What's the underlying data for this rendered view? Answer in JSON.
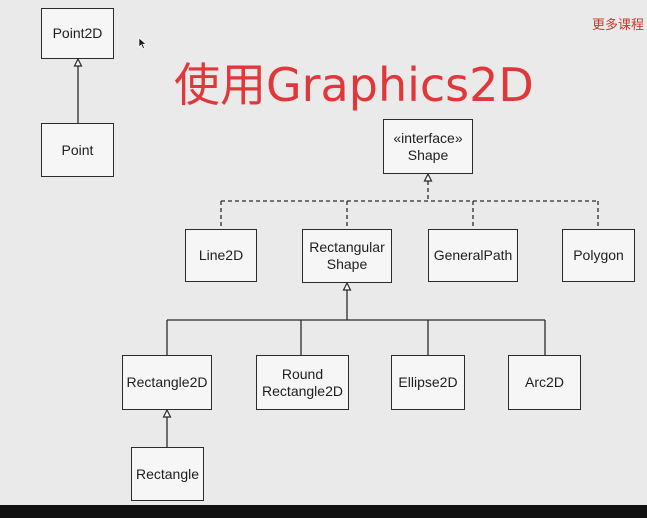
{
  "title": "使用Graphics2D",
  "corner_link": "更多课程",
  "classes": {
    "point2d": "Point2D",
    "point": "Point",
    "shape": "«interface»\nShape",
    "line2d": "Line2D",
    "rectangular_shape": "Rectangular\nShape",
    "general_path": "GeneralPath",
    "polygon": "Polygon",
    "rectangle2d": "Rectangle2D",
    "round_rectangle2d": "Round\nRectangle2D",
    "ellipse2d": "Ellipse2D",
    "arc2d": "Arc2D",
    "rectangle": "Rectangle"
  },
  "colors": {
    "title": "#e0383a",
    "corner_link": "#c63b2f",
    "background": "#eaeaea",
    "line": "#2b2b2b"
  },
  "icons": [
    "mouse-cursor-icon"
  ]
}
